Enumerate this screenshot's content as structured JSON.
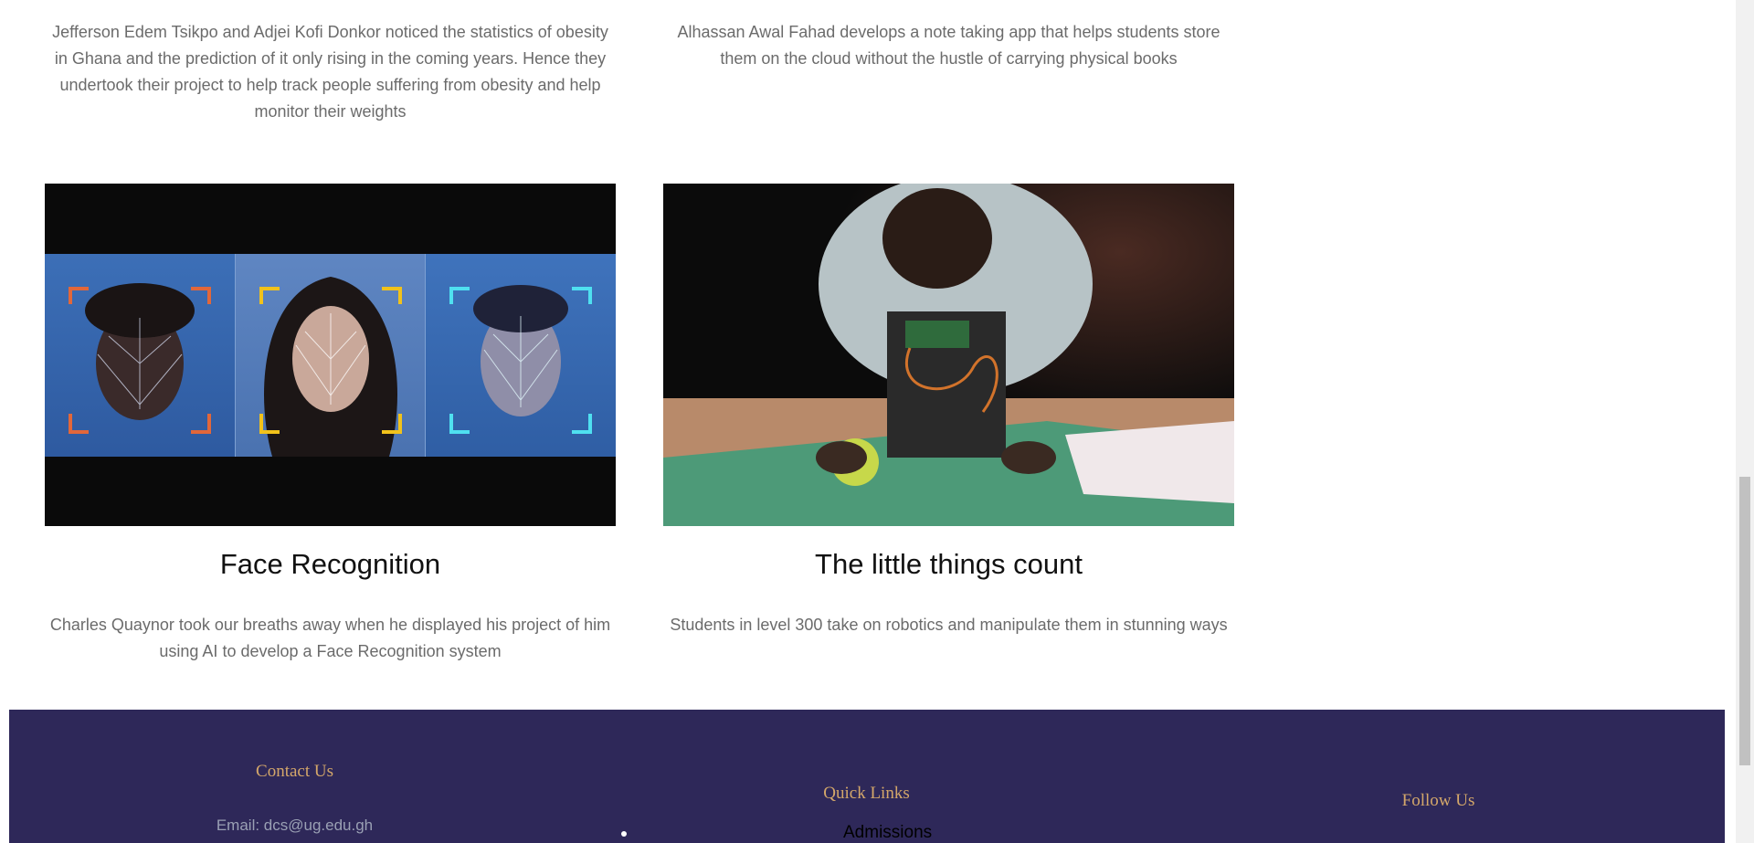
{
  "cards_top": [
    {
      "description": "Jefferson Edem Tsikpo and Adjei Kofi Donkor noticed the statistics of obesity in Ghana and the prediction of it only rising in the coming years. Hence they undertook their project to help track people suffering from obesity and help monitor their weights"
    },
    {
      "description": "Alhassan Awal Fahad develops a note taking app that helps students store them on the cloud without the hustle of carrying physical books"
    }
  ],
  "cards": [
    {
      "title": "Face Recognition",
      "description": "Charles Quaynor took our breaths away when he displayed his project of him using AI to develop a Face Recognition system"
    },
    {
      "title": "The little things count",
      "description": "Students in level 300 take on robotics and manipulate them in stunning ways"
    }
  ],
  "footer": {
    "contact": {
      "heading": "Contact Us",
      "email": "Email: dcs@ug.edu.gh"
    },
    "quick_links": {
      "heading": "Quick Links",
      "items": [
        "Admissions"
      ]
    },
    "follow": {
      "heading": "Follow Us"
    }
  },
  "colors": {
    "footer_bg": "#2e2859",
    "footer_heading": "#d4a76a"
  }
}
